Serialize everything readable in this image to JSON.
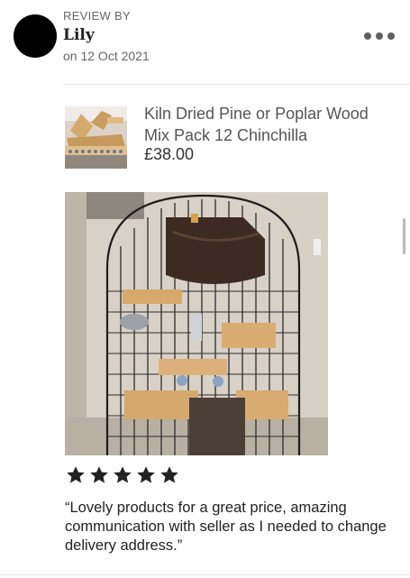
{
  "review": {
    "label": "REVIEW BY",
    "reviewer_name": "Lily",
    "date_text": "on 12 Oct 2021",
    "rating": 5,
    "text": "“Lovely products for a great price, amazing communication with seller as I needed to change delivery address.”"
  },
  "product": {
    "title": "Kiln Dried Pine or Poplar Wood Mix Pack 12 Chinchilla",
    "price": "£38.00"
  },
  "icons": {
    "more": "more-options-icon",
    "star": "star-icon"
  },
  "colors": {
    "avatar": "#000000",
    "star": "#222222",
    "divider": "#e4e4e4"
  }
}
